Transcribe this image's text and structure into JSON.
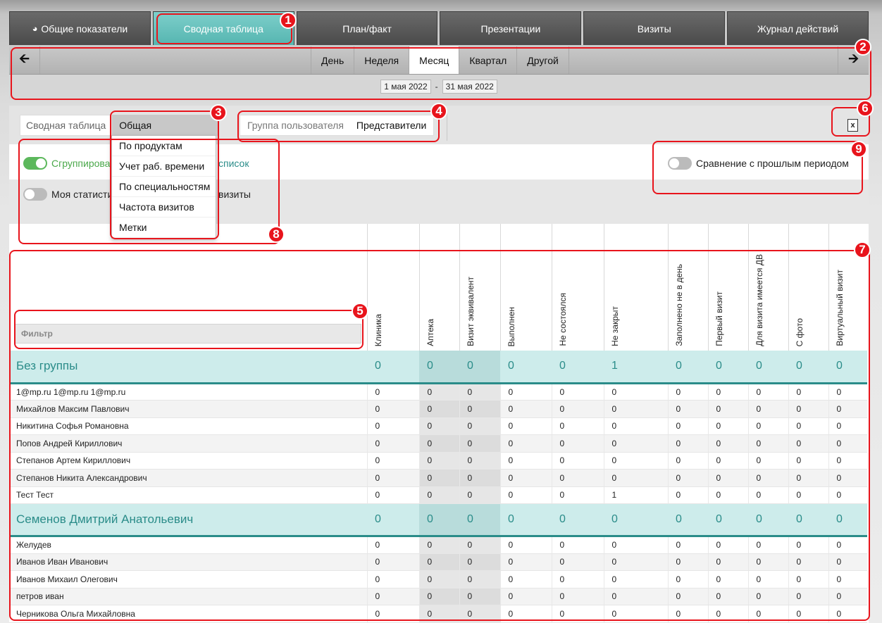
{
  "tabs": [
    {
      "label": "Общие показатели",
      "icon": "gauge-icon"
    },
    {
      "label": "Сводная таблица"
    },
    {
      "label": "План/факт"
    },
    {
      "label": "Презентации"
    },
    {
      "label": "Визиты"
    },
    {
      "label": "Журнал действий"
    }
  ],
  "period": {
    "tabs": [
      "День",
      "Неделя",
      "Месяц",
      "Квартал",
      "Другой"
    ],
    "active": "Месяц",
    "date_from": "1 мая 2022",
    "date_sep": "-",
    "date_to": "31 мая 2022"
  },
  "filters": {
    "table_label": "Сводная таблица",
    "table_value": "Общая",
    "group_label": "Группа пользователя",
    "group_value": "Представители"
  },
  "dropdown": [
    "По продуктам",
    "Учет раб. времени",
    "По специальностям",
    "Частота визитов",
    "Метки"
  ],
  "toggles": {
    "grouped_visible": "Сгруппирова",
    "grouped_tail": "список",
    "my_stats_visible": "Моя статисти",
    "my_stats_tail": "визиты",
    "compare": "Сравнение с прошлым периодом"
  },
  "table": {
    "filter_placeholder": "Фильтр",
    "columns": [
      "Клиника",
      "Аптека",
      "Визит эквивалент",
      "Выполнен",
      "Не состоялся",
      "Не закрыт",
      "Заполнено не в день",
      "Первый визит",
      "Для визита имеется ДВ",
      "С фото",
      "Виртуальный визит"
    ],
    "groups": [
      {
        "name": "Без группы",
        "totals": [
          "0",
          "0",
          "0",
          "0",
          "0",
          "1",
          "0",
          "0",
          "0",
          "0",
          "0"
        ],
        "rows": [
          {
            "name": "1@mp.ru 1@mp.ru 1@mp.ru",
            "values": [
              "0",
              "0",
              "0",
              "0",
              "0",
              "0",
              "0",
              "0",
              "0",
              "0",
              "0"
            ]
          },
          {
            "name": "Михайлов Максим Павлович",
            "values": [
              "0",
              "0",
              "0",
              "0",
              "0",
              "0",
              "0",
              "0",
              "0",
              "0",
              "0"
            ]
          },
          {
            "name": "Никитина Софья Романовна",
            "values": [
              "0",
              "0",
              "0",
              "0",
              "0",
              "0",
              "0",
              "0",
              "0",
              "0",
              "0"
            ]
          },
          {
            "name": "Попов Андрей Кириллович",
            "values": [
              "0",
              "0",
              "0",
              "0",
              "0",
              "0",
              "0",
              "0",
              "0",
              "0",
              "0"
            ]
          },
          {
            "name": "Степанов Артем Кириллович",
            "values": [
              "0",
              "0",
              "0",
              "0",
              "0",
              "0",
              "0",
              "0",
              "0",
              "0",
              "0"
            ]
          },
          {
            "name": "Степанов Никита Александрович",
            "values": [
              "0",
              "0",
              "0",
              "0",
              "0",
              "0",
              "0",
              "0",
              "0",
              "0",
              "0"
            ]
          },
          {
            "name": "Тест Тест",
            "values": [
              "0",
              "0",
              "0",
              "0",
              "0",
              "1",
              "0",
              "0",
              "0",
              "0",
              "0"
            ]
          }
        ]
      },
      {
        "name": "Семенов Дмитрий Анатольевич",
        "totals": [
          "0",
          "0",
          "0",
          "0",
          "0",
          "0",
          "0",
          "0",
          "0",
          "0",
          "0"
        ],
        "rows": [
          {
            "name": "Желудев",
            "values": [
              "0",
              "0",
              "0",
              "0",
              "0",
              "0",
              "0",
              "0",
              "0",
              "0",
              "0"
            ]
          },
          {
            "name": "Иванов Иван Иванович",
            "values": [
              "0",
              "0",
              "0",
              "0",
              "0",
              "0",
              "0",
              "0",
              "0",
              "0",
              "0"
            ]
          },
          {
            "name": "Иванов Михаил Олегович",
            "values": [
              "0",
              "0",
              "0",
              "0",
              "0",
              "0",
              "0",
              "0",
              "0",
              "0",
              "0"
            ]
          },
          {
            "name": "петров иван",
            "values": [
              "0",
              "0",
              "0",
              "0",
              "0",
              "0",
              "0",
              "0",
              "0",
              "0",
              "0"
            ]
          },
          {
            "name": "Черникова Ольга Михайловна",
            "values": [
              "0",
              "0",
              "0",
              "0",
              "0",
              "0",
              "0",
              "0",
              "0",
              "0",
              "0"
            ]
          }
        ]
      }
    ]
  },
  "annotations": [
    "1",
    "2",
    "3",
    "4",
    "5",
    "6",
    "7",
    "8",
    "9"
  ],
  "colors": {
    "accent": "#55b5b0",
    "annotation": "#e8141c",
    "toggle_on": "#5cb85c"
  }
}
